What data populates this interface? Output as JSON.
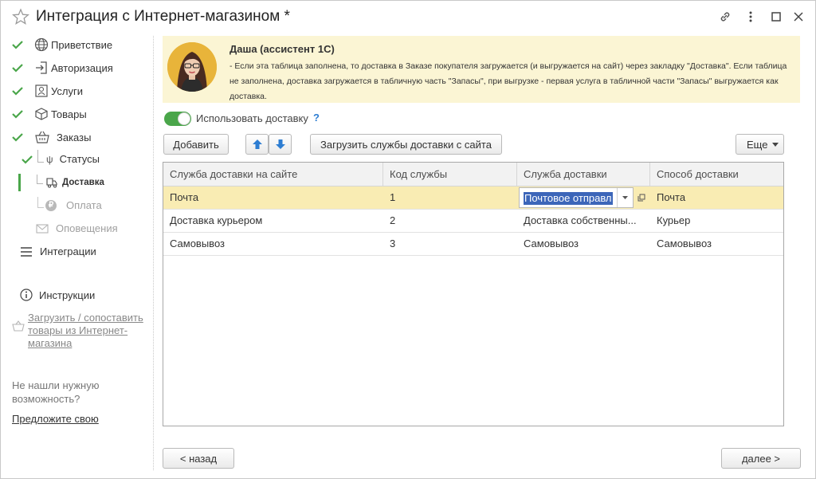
{
  "window": {
    "title": "Интеграция с Интернет-магазином *"
  },
  "sidebar": {
    "items": [
      {
        "label": "Приветствие",
        "done": true
      },
      {
        "label": "Авторизация",
        "done": true
      },
      {
        "label": "Услуги",
        "done": true
      },
      {
        "label": "Товары",
        "done": true
      },
      {
        "label": "Заказы",
        "done": true
      }
    ],
    "subitems": [
      {
        "label": "Статусы",
        "done": true
      },
      {
        "label": "Доставка",
        "current": true
      },
      {
        "label": "Оплата",
        "disabled": true
      },
      {
        "label": "Оповещения",
        "disabled": true
      }
    ],
    "integrations_label": "Интеграции",
    "instructions_label": "Инструкции",
    "load_link": "Загрузить / сопоставить товары из Интернет-магазина",
    "hint_text": "Не нашли нужную возможность?",
    "suggest_link": "Предложите свою"
  },
  "assistant": {
    "name": "Даша (ассистент 1С)",
    "text": "- Если эта таблица заполнена, то доставка в Заказе покупателя загружается (и выгружается на сайт) через закладку \"Доставка\". Если таблица не заполнена, доставка загружается в табличную часть \"Запасы\", при выгрузке - первая услуга в табличной части \"Запасы\" выгружается как доставка."
  },
  "delivery_toggle": {
    "label": "Использовать доставку",
    "help": "?",
    "on": true
  },
  "toolbar": {
    "add_label": "Добавить",
    "load_label": "Загрузить службы доставки с сайта",
    "more_label": "Еще"
  },
  "table": {
    "columns": [
      "Служба доставки на сайте",
      "Код службы",
      "Служба доставки",
      "Способ доставки"
    ],
    "rows": [
      {
        "site_service": "Почта",
        "code": "1",
        "service": "Почтовое отправл",
        "method": "Почта"
      },
      {
        "site_service": "Доставка курьером",
        "code": "2",
        "service": "Доставка собственны...",
        "method": "Курьер"
      },
      {
        "site_service": "Самовывоз",
        "code": "3",
        "service": "Самовывоз",
        "method": "Самовывоз"
      }
    ]
  },
  "footer": {
    "back_label": "< назад",
    "next_label": "далее >"
  },
  "colors": {
    "accent_green": "#4aa64a",
    "assistant_bg": "#fbf5d4",
    "selected_row": "#f9ecb3",
    "selection": "#3c66b9",
    "arrow_blue": "#2d7dd2"
  }
}
